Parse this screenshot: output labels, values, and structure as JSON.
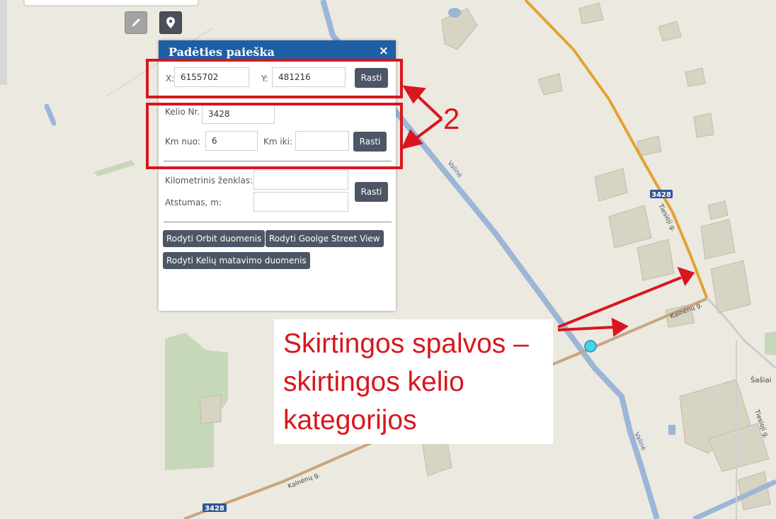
{
  "panel": {
    "title": "Padėties paieška",
    "close_glyph": "×",
    "coords": {
      "x_label": "X:",
      "x_value": "6155702",
      "y_label": "Y:",
      "y_value": "481216",
      "find_label": "Rasti"
    },
    "road": {
      "road_no_label": "Kelio Nr.",
      "road_no_value": "3428",
      "km_from_label": "Km nuo:",
      "km_from_value": "6",
      "km_to_label": "Km iki:",
      "km_to_value": "",
      "find_label": "Rasti"
    },
    "marker": {
      "km_sign_label": "Kilometrinis ženklas:",
      "distance_label": "Atstumas, m:",
      "km_sign_value": "",
      "distance_value": "",
      "find_label": "Rasti"
    },
    "actions": [
      "Rodyti Orbit duomenis",
      "Rodyti Goolge Street View",
      "Rodyti Kelių matavimo duomenis"
    ]
  },
  "toolbar": {
    "ruler_icon": "pencil-ruler-icon",
    "pin_icon": "map-pin-icon"
  },
  "annotations": {
    "number_label": "2",
    "note_lines": [
      "Skirtingos spalvos –",
      "skirtingos kelio",
      "kategorijos"
    ],
    "color": "#d8171f"
  },
  "map": {
    "road_shields": [
      "3428",
      "3428"
    ],
    "street_names": [
      "Tiesioji g.",
      "Kalnėnų g.",
      "Kalnėnų g.",
      "Tiesioji g."
    ],
    "canal_names": [
      "Valinė",
      "Valinė"
    ],
    "place_name": "Šašiai",
    "colors": {
      "background": "#ece9e1",
      "building": "#d8d4c4",
      "water": "#9bb6d6",
      "road_orange": "#e3a234",
      "road_brown": "#c9a67f",
      "green": "#c7d8b9",
      "marker": "#44d4ee"
    }
  }
}
